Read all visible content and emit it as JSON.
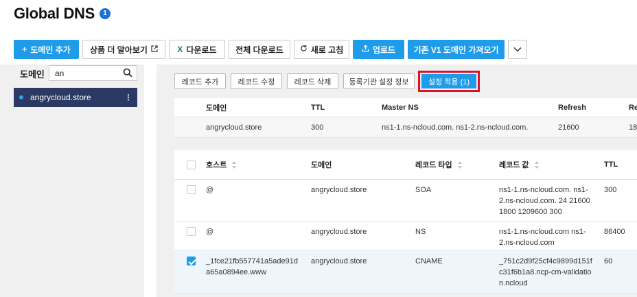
{
  "header": {
    "title": "Global DNS",
    "badge": "1"
  },
  "toolbar": {
    "add_domain": "도메인 추가",
    "learn_more": "상품 더 알아보기",
    "download": "다운로드",
    "download_all": "전체 다운로드",
    "refresh": "새로 고침",
    "upload": "업로드",
    "import_v1": "기존 V1 도메인 가져오기"
  },
  "sidebar": {
    "label": "도메인",
    "search_value": "an",
    "domains": [
      {
        "name": "angrycloud.store"
      }
    ]
  },
  "record_actions": {
    "add": "레코드 추가",
    "edit": "레코드 수정",
    "delete": "레코드 삭제",
    "registrar": "등록기관 설정 정보",
    "apply": "설정 적용 (1)"
  },
  "soa_table": {
    "headers": {
      "domain": "도메인",
      "ttl": "TTL",
      "master_ns": "Master NS",
      "refresh": "Refresh",
      "retry": "Re"
    },
    "row": {
      "domain": "angrycloud.store",
      "ttl": "300",
      "master_ns": "ns1-1.ns-ncloud.com. ns1-2.ns-ncloud.com.",
      "refresh": "21600",
      "retry": "18"
    }
  },
  "records_table": {
    "headers": {
      "host": "호스트",
      "domain": "도메인",
      "type": "레코드 타입",
      "value": "레코드 값",
      "ttl": "TTL"
    },
    "rows": [
      {
        "host": "@",
        "domain": "angrycloud.store",
        "type": "SOA",
        "value": "ns1-1.ns-ncloud.com. ns1-2.ns-ncloud.com. 24 21600 1800 1209600 300",
        "ttl": "300",
        "checked": false
      },
      {
        "host": "@",
        "domain": "angrycloud.store",
        "type": "NS",
        "value": "ns1-1.ns-ncloud.com ns1-2.ns-ncloud.com",
        "ttl": "86400",
        "checked": false
      },
      {
        "host": "_1fce21fb557741a5ade91da65a0894ee.www",
        "domain": "angrycloud.store",
        "type": "CNAME",
        "value": "_751c2d9f25cf4c9899d151fc31f6b1a8.ncp-cm-validation.ncloud",
        "ttl": "60",
        "checked": true
      }
    ]
  },
  "colors": {
    "primary": "#1f9ce9",
    "sidebar_selected": "#2b3a62",
    "highlight_border": "#e0102a",
    "badge": "#1a73d9"
  }
}
